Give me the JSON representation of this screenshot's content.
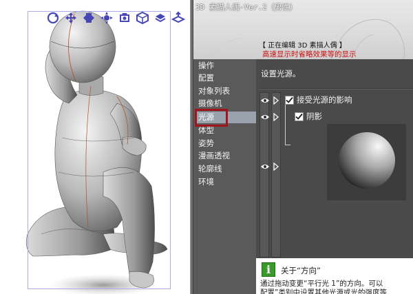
{
  "header": {
    "title": "3D 素描人偶-Ver.2（男性）",
    "editing": "【 正在编辑 3D 素描人偶 】",
    "warning": "高速显示时省略效果等的显示"
  },
  "nav": {
    "items": [
      {
        "label": "操作"
      },
      {
        "label": "配置"
      },
      {
        "label": "对象列表"
      },
      {
        "label": "摄像机"
      },
      {
        "label": "光源",
        "selected": true
      },
      {
        "label": "体型"
      },
      {
        "label": "姿势"
      },
      {
        "label": "漫画透视"
      },
      {
        "label": "轮廓线"
      },
      {
        "label": "环境"
      }
    ]
  },
  "content": {
    "title": "设置光源。",
    "options": [
      {
        "label": "接受光源的影响",
        "checked": true
      },
      {
        "label": "阴影",
        "checked": true
      }
    ]
  },
  "info": {
    "title": "关于“方向”",
    "body": "通过拖动变更“平行光 1”的方向。可以",
    "body2": "配置”类别中设置其他光源或光的强度等"
  },
  "toolbar": {
    "icons": [
      "rotate-icon",
      "pan-icon",
      "move-icon",
      "gizmo-icon",
      "camera-rotate-icon",
      "object-rotate-icon",
      "object-move-icon",
      "floor-move-icon"
    ]
  },
  "colors": {
    "panel_bg": "#4f4f4f",
    "nav_selected": "#9aa3ad",
    "highlight_box": "#a0151b",
    "warning_text": "#cc1111",
    "info_icon": "#3a9b2c",
    "toolbar_icon": "#4646b4"
  }
}
